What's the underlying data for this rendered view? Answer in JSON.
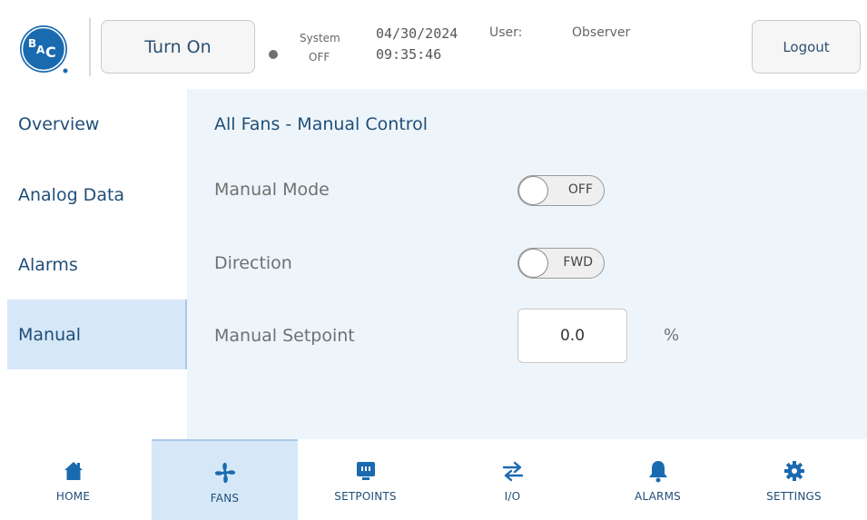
{
  "header": {
    "logo_text": "BAC",
    "turn_on_label": "Turn On",
    "system_label": "System",
    "system_state": "OFF",
    "date": "04/30/2024",
    "time": "09:35:46",
    "user_label": "User:",
    "user_name": "Observer",
    "logout_label": "Logout",
    "status_dot_color": "#707070",
    "brand_color": "#1a6ab0"
  },
  "sidebar": {
    "items": [
      {
        "label": "Overview",
        "active": false
      },
      {
        "label": "Analog Data",
        "active": false
      },
      {
        "label": "Alarms",
        "active": false
      },
      {
        "label": "Manual",
        "active": true
      }
    ]
  },
  "main": {
    "title": "All Fans - Manual Control",
    "manual_mode": {
      "label": "Manual Mode",
      "state": "OFF"
    },
    "direction": {
      "label": "Direction",
      "state": "FWD"
    },
    "setpoint": {
      "label": "Manual Setpoint",
      "value": "0.0",
      "unit": "%"
    }
  },
  "bottom_nav": {
    "items": [
      {
        "label": "HOME",
        "icon": "home-icon",
        "active": false
      },
      {
        "label": "FANS",
        "icon": "fan-icon",
        "active": true
      },
      {
        "label": "SETPOINTS",
        "icon": "setpoints-icon",
        "active": false
      },
      {
        "label": "I/O",
        "icon": "io-arrows-icon",
        "active": false
      },
      {
        "label": "ALARMS",
        "icon": "bell-icon",
        "active": false
      },
      {
        "label": "SETTINGS",
        "icon": "gear-icon",
        "active": false
      }
    ]
  },
  "colors": {
    "accent": "#1a6ab0",
    "text_primary": "#1f4e79",
    "active_bg": "#d6e8f8",
    "panel_bg": "#eef5fa"
  }
}
